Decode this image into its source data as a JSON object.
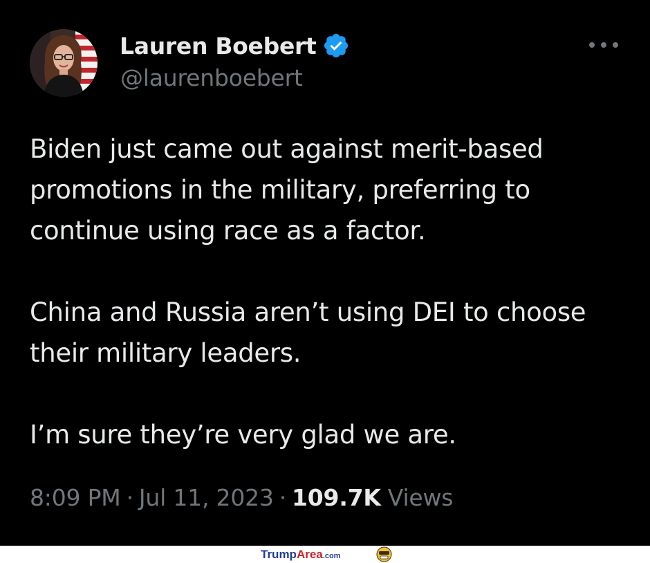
{
  "author": {
    "display_name": "Lauren Boebert",
    "handle": "@laurenboebert",
    "verified": true
  },
  "icons": {
    "avatar": "profile-photo",
    "verified": "verified-badge-icon",
    "more": "more-options-icon",
    "watermark_face": "emoji-face-icon"
  },
  "tweet": {
    "paragraphs": [
      "Biden just came out against merit-based promotions in the military, preferring to continue using race as a factor.",
      "China and Russia aren’t using DEI to choose their military leaders.",
      "I’m sure they’re very glad we are."
    ],
    "time": "8:09 PM",
    "separator": "·",
    "date": "Jul 11, 2023",
    "views_count": "109.7K",
    "views_label": "Views"
  },
  "watermark": {
    "brand_part1": "Trump",
    "brand_part2": "Area",
    "brand_suffix": ".com"
  },
  "colors": {
    "background": "#000000",
    "text_primary": "#e7e9ea",
    "text_secondary": "#71767b",
    "verified_blue": "#1d9bf0"
  }
}
